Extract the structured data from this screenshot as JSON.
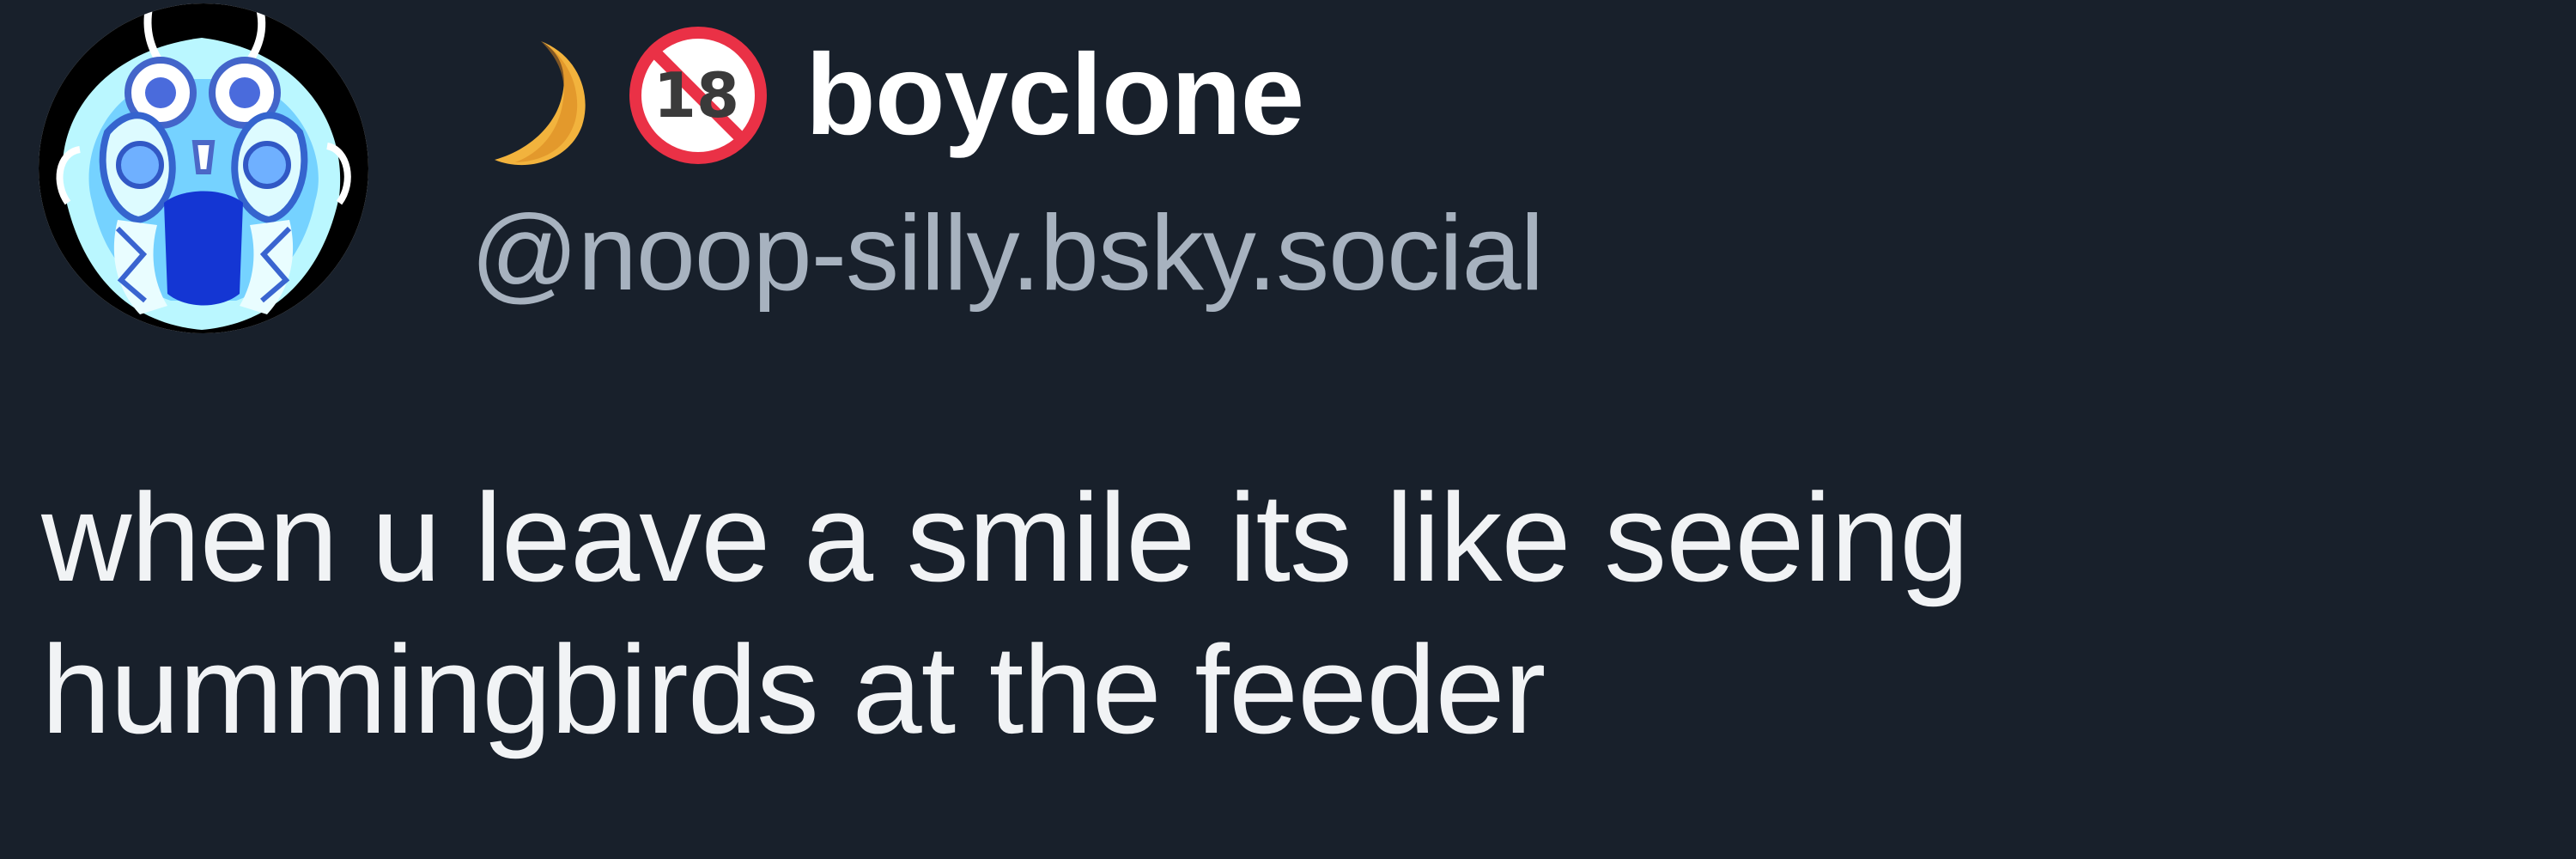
{
  "post": {
    "author": {
      "display_name": "boyclone",
      "handle": "@noop-silly.bsky.social",
      "avatar_icon": "anime-avatar-icon",
      "badges": [
        {
          "icon": "crescent-moon-icon",
          "color": "#f2b33d"
        },
        {
          "icon": "no-under-18-icon",
          "color": "#ea3146",
          "label": "18"
        }
      ]
    },
    "text": "when u leave a smile its like seeing\nhummingbirds at the feeder"
  },
  "colors": {
    "background": "#18202b",
    "display_name": "#ffffff",
    "handle": "#a7b2bf",
    "body_text": "#f1f3f5"
  }
}
